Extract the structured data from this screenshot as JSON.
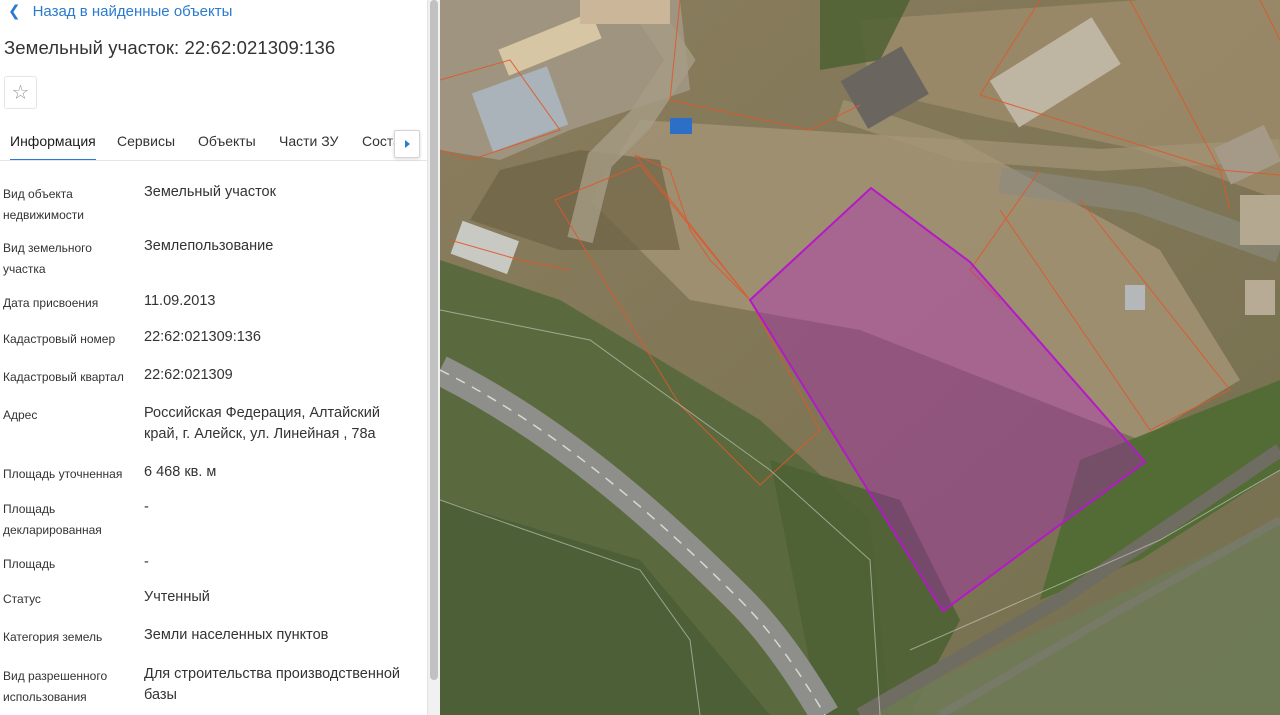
{
  "nav": {
    "back_label": "Назад в найденные объекты"
  },
  "object": {
    "title": "Земельный участок: 22:62:021309:136"
  },
  "favorite_icon": "star-outline-icon",
  "tabs": [
    {
      "label": "Информация",
      "active": true
    },
    {
      "label": "Сервисы",
      "active": false
    },
    {
      "label": "Объекты",
      "active": false
    },
    {
      "label": "Части ЗУ",
      "active": false
    },
    {
      "label": "Состав ЗУ",
      "active": false
    }
  ],
  "properties": [
    {
      "label": "Вид объекта недвижимости",
      "value": "Земельный участок"
    },
    {
      "label": "Вид земельного участка",
      "value": "Землепользование"
    },
    {
      "label": "Дата присвоения",
      "value": "11.09.2013"
    },
    {
      "label": "Кадастровый номер",
      "value": "22:62:021309:136"
    },
    {
      "label": "Кадастровый квартал",
      "value": "22:62:021309"
    },
    {
      "label": "Адрес",
      "value": "Российская Федерация, Алтайский край, г. Алейск, ул. Линейная , 78а"
    },
    {
      "label": "Площадь уточненная",
      "value": "6 468 кв. м"
    },
    {
      "label": "Площадь декларированная",
      "value": "-"
    },
    {
      "label": "Площадь",
      "value": "-"
    },
    {
      "label": "Статус",
      "value": "Учтенный"
    },
    {
      "label": "Категория земель",
      "value": "Земли населенных пунктов"
    },
    {
      "label": "Вид разрешенного использования",
      "value": "Для строительства производственной базы"
    }
  ],
  "colors": {
    "accent": "#2a7ad0",
    "selected_parcel": "#b419c8",
    "parcel_border": "#e0572a"
  }
}
